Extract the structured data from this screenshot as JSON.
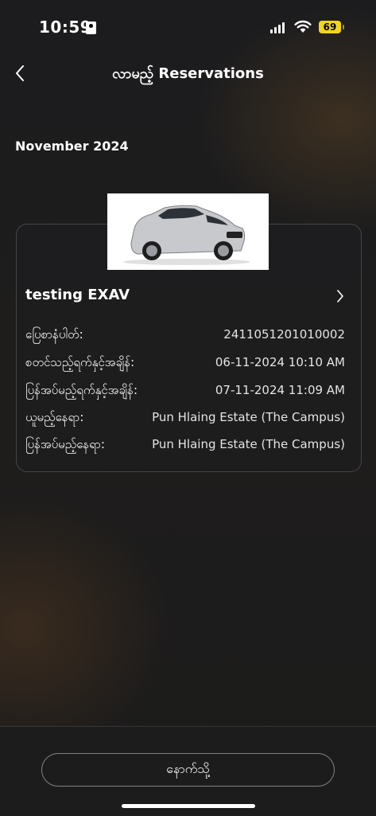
{
  "status_bar": {
    "time": "10:59",
    "battery": "69"
  },
  "header": {
    "title": "လာမည့် Reservations"
  },
  "month": "November 2024",
  "reservation": {
    "car_name": "testing EXAV",
    "rows": [
      {
        "label": "ပြေစာနံပါတ်:",
        "value": "2411051201010002"
      },
      {
        "label": "စတင်သည့်ရက်နှင့်အချိန်:",
        "value": "06-11-2024 10:10 AM"
      },
      {
        "label": "ပြန်အပ်မည့်ရက်နှင့်အချိန်:",
        "value": "07-11-2024 11:09 AM"
      },
      {
        "label": "ယူမည့်နေရာ:",
        "value": "Pun Hlaing Estate (The Campus)"
      },
      {
        "label": "ပြန်အပ်မည့်နေရာ:",
        "value": "Pun Hlaing Estate (The Campus)"
      }
    ]
  },
  "footer": {
    "back_label": "နောက်သို့"
  }
}
